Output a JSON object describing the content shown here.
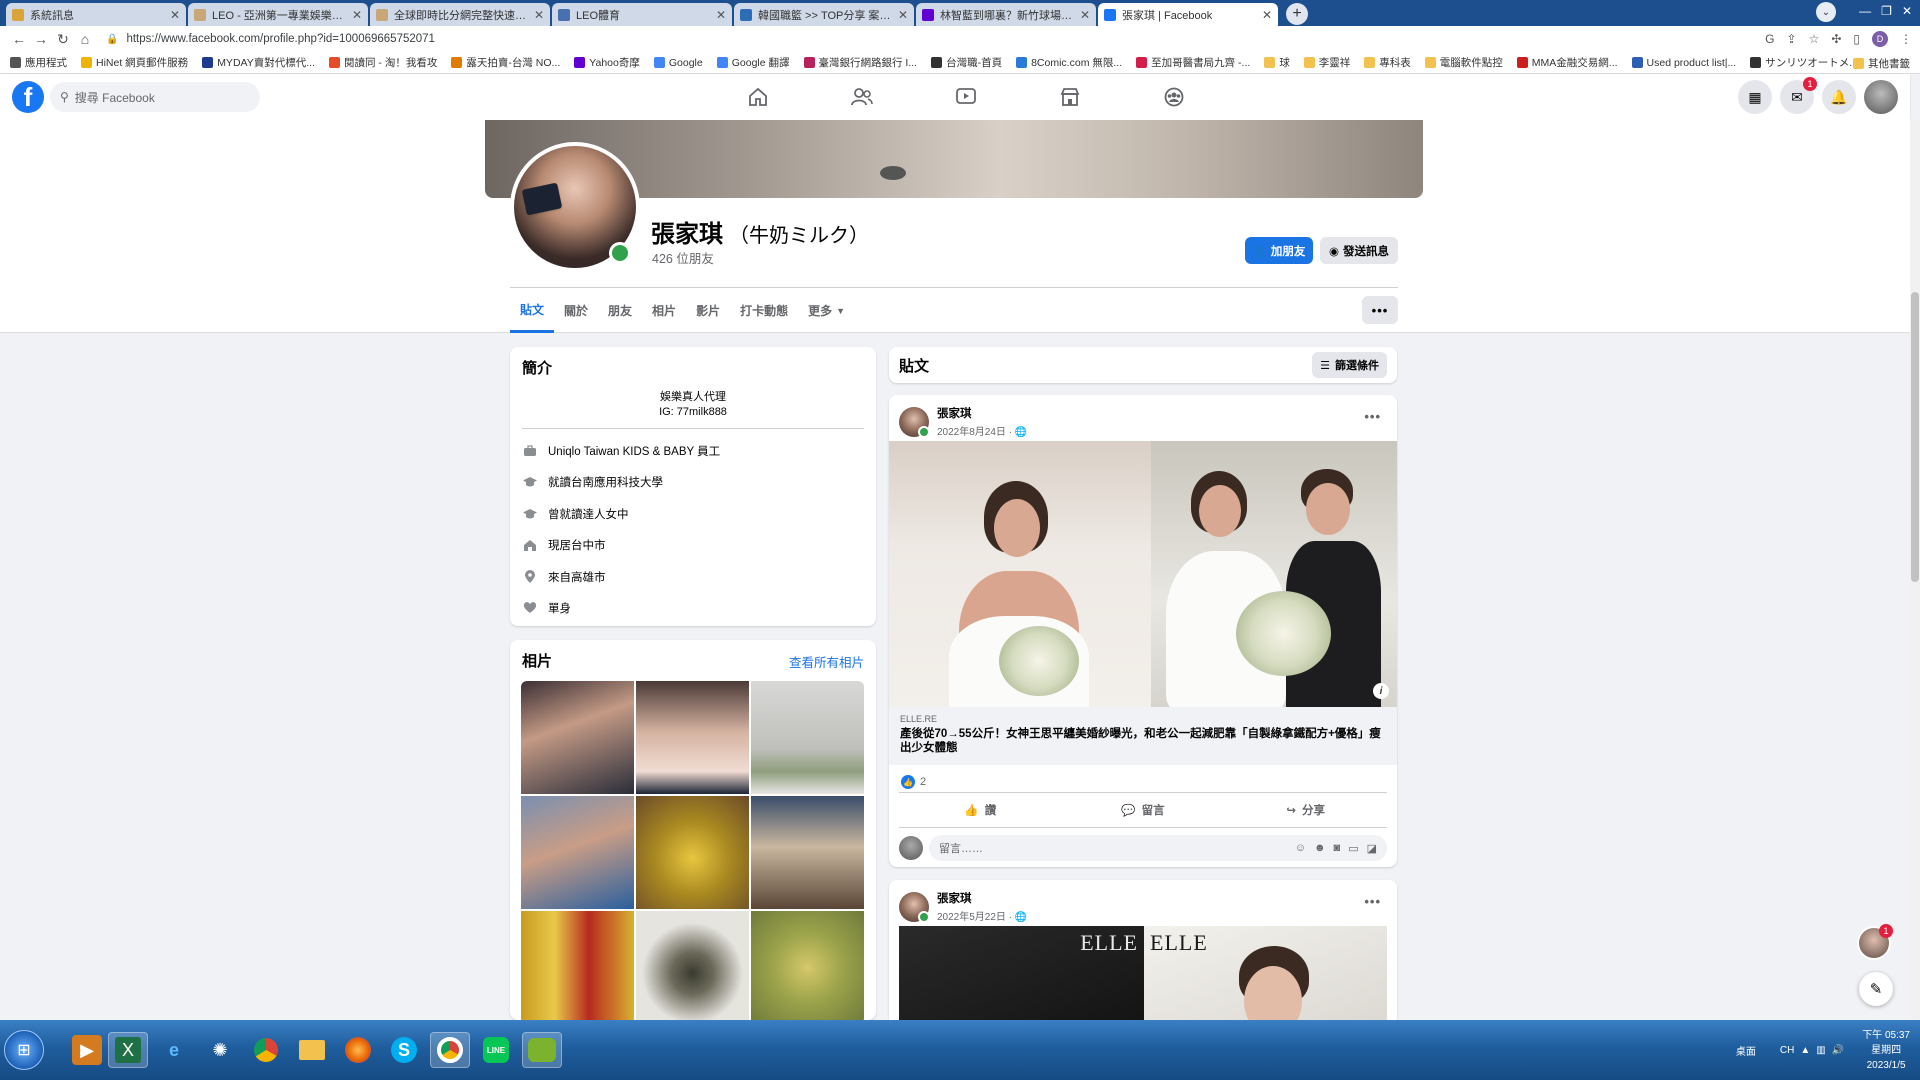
{
  "browser": {
    "tabs": [
      {
        "title": "系統訊息",
        "icon": "mail-icon",
        "color": "#d9a43a",
        "active": false
      },
      {
        "title": "LEO - 亞洲第一專業娛樂品牌 -",
        "icon": "leo-icon",
        "color": "#c8a878",
        "active": false
      },
      {
        "title": "全球即時比分網完整快速的提供",
        "icon": "leo-icon",
        "color": "#c8a878",
        "active": false
      },
      {
        "title": "LEO體育",
        "icon": "globe-icon",
        "color": "#4a6fb0",
        "active": false
      },
      {
        "title": "韓國職籃 >> TOP分享 案場VS",
        "icon": "tt-icon",
        "color": "#2c6db5",
        "active": false
      },
      {
        "title": "林智藍到哪裏？新竹球場錶失去",
        "icon": "yahoo-icon",
        "color": "#6001d2",
        "active": false
      },
      {
        "title": "張家琪 | Facebook",
        "icon": "facebook-icon",
        "color": "#1877f2",
        "active": true
      }
    ],
    "new_tab": "+",
    "url": "https://www.facebook.com/profile.php?id=100069665752071",
    "bookmarks": [
      {
        "label": "應用程式",
        "color": "#555"
      },
      {
        "label": "HiNet 網頁郵件服務",
        "color": "#f0b400"
      },
      {
        "label": "MYDAY賣對代標代...",
        "color": "#1d3c8f"
      },
      {
        "label": "閱讀同 - 淘！我看攻",
        "color": "#e64c2a"
      },
      {
        "label": "露天拍賣-台灣 NO...",
        "color": "#e07b00"
      },
      {
        "label": "Yahoo奇摩",
        "color": "#6001d2"
      },
      {
        "label": "Google",
        "color": "#4285f4"
      },
      {
        "label": "Google 翻譯",
        "color": "#4285f4"
      },
      {
        "label": "臺灣銀行網路銀行 I...",
        "color": "#b5225c"
      },
      {
        "label": "台灣職-首頁",
        "color": "#333"
      },
      {
        "label": "8Comic.com 無限...",
        "color": "#2a7bd8"
      },
      {
        "label": "至加哥醫書局九齊 -...",
        "color": "#d41e4a"
      },
      {
        "label": "球",
        "color": "#f2c14e"
      },
      {
        "label": "李靈祥",
        "color": "#f2c14e"
      },
      {
        "label": "專科表",
        "color": "#f2c14e"
      },
      {
        "label": "電腦軟件點控",
        "color": "#f2c14e"
      },
      {
        "label": "MMA金融交易網...",
        "color": "#cc1f1f"
      },
      {
        "label": "Used product list|...",
        "color": "#2f5fb3"
      },
      {
        "label": "サンリツオートメ...",
        "color": "#333"
      }
    ],
    "bookmarks_more": "其他書籤"
  },
  "fb": {
    "search_placeholder": "搜尋 Facebook",
    "messenger_badge": "1"
  },
  "profile": {
    "name": "張家琪",
    "alt_name": "（牛奶ミルク）",
    "friends": "426 位朋友",
    "add_friend": "加朋友",
    "send_message": "發送訊息",
    "tabs": [
      "貼文",
      "關於",
      "朋友",
      "相片",
      "影片",
      "打卡動態",
      "更多"
    ],
    "more_dots": "•••"
  },
  "intro": {
    "title": "簡介",
    "bio_line1": "娛樂真人代理",
    "bio_line2": "IG: 77milk888",
    "rows": [
      {
        "icon": "work-icon",
        "text": "Uniqlo Taiwan KIDS & BABY 員工"
      },
      {
        "icon": "education-icon",
        "text": "就讀台南應用科技大學"
      },
      {
        "icon": "education-icon",
        "text": "曾就讀達人女中"
      },
      {
        "icon": "home-icon",
        "text": "現居台中市"
      },
      {
        "icon": "location-icon",
        "text": "來自高雄市"
      },
      {
        "icon": "heart-icon",
        "text": "單身"
      }
    ]
  },
  "photos": {
    "title": "相片",
    "see_all": "查看所有相片"
  },
  "posts": {
    "title": "貼文",
    "filter": "篩選條件",
    "post1": {
      "author": "張家琪",
      "date": "2022年8月24日 · ",
      "link_source": "ELLE.RE",
      "link_title": "產後從70→55公斤！女神王思平纏美婚紗曝光，和老公一起減肥靠「自製綠拿鐵配方+優格」瘦出少女體態",
      "reactions": "2",
      "like": "讚",
      "comment": "留言",
      "share": "分享",
      "comment_placeholder": "留言……"
    },
    "post2": {
      "author": "張家琪",
      "date": "2022年5月22日 · ",
      "magazine": "ELLE"
    }
  },
  "taskbar": {
    "desktop": "桌面",
    "time": "下午 05:37",
    "weekday": "星期四",
    "date": "2023/1/5",
    "ime": "CH"
  }
}
